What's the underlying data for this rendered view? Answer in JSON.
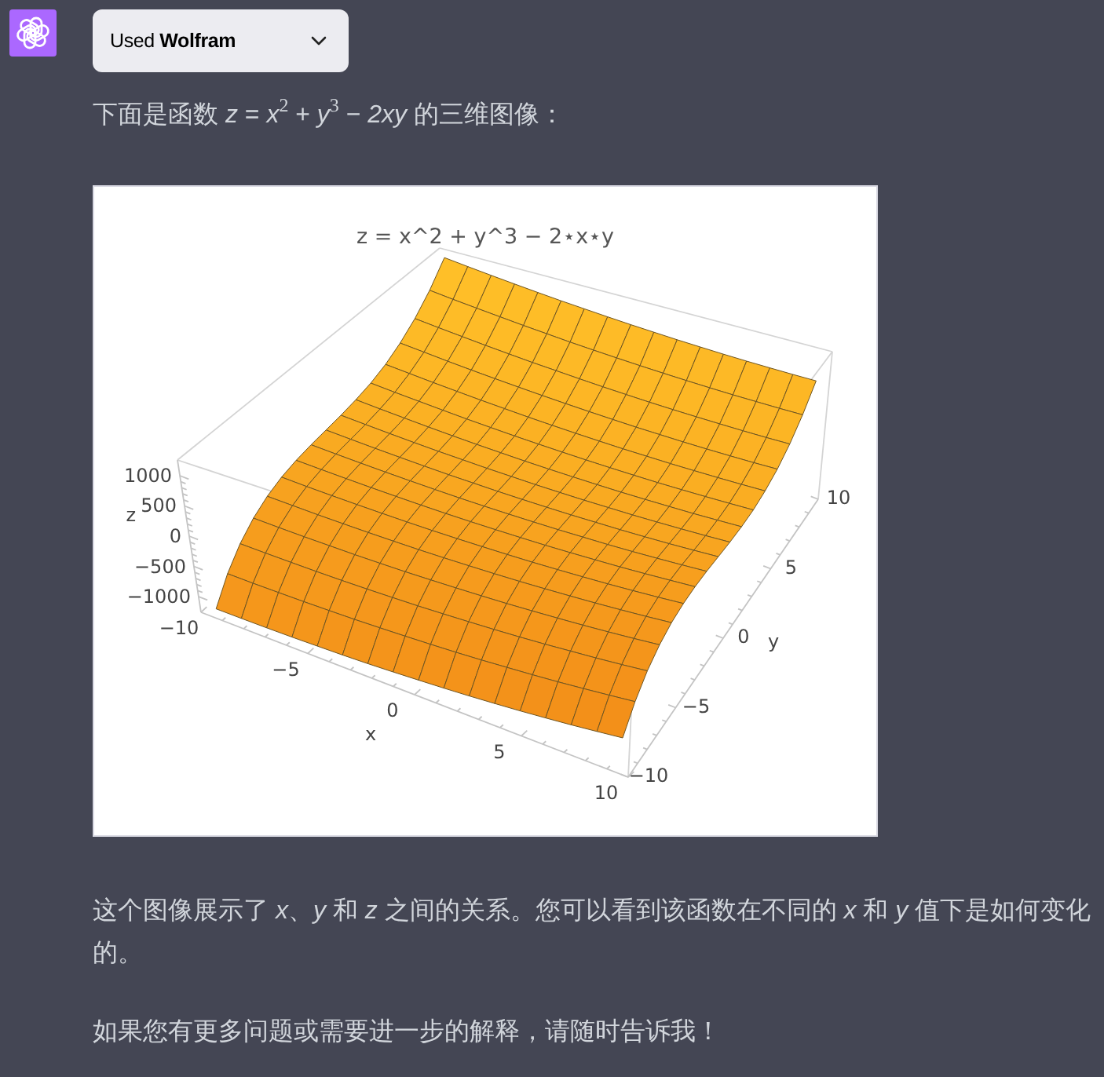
{
  "plugin_button": {
    "label": "Used **Wolfram**",
    "expanded": false
  },
  "blocks": [
    {
      "kind": "text",
      "text": "下面是函数 *z* = *x*$^{2}$ + *y*$^{3}$ − *2xy* 的三维图像："
    },
    {
      "kind": "plot",
      "title": "z = x^2 + y^3 − 2⋆x⋆y",
      "z_axis": {
        "label": "z",
        "ticks": [
          "1000",
          "500",
          "0",
          "−500",
          "−1000"
        ]
      },
      "x_axis": {
        "label": "x",
        "ticks": [
          "−10",
          "−5",
          "0",
          "5",
          "10"
        ]
      },
      "y_axis": {
        "label": "y",
        "ticks": [
          "−10",
          "−5",
          "0",
          "5",
          "10"
        ]
      }
    },
    {
      "kind": "text",
      "text": "这个图像展示了 *x*、*y* 和 *z* 之间的关系。您可以看到该函数在不同的 *x* 和 *y* 值下是如何变化的。"
    },
    {
      "kind": "text",
      "text": "如果您有更多问题或需要进一步的解释，请随时告诉我！"
    }
  ]
}
